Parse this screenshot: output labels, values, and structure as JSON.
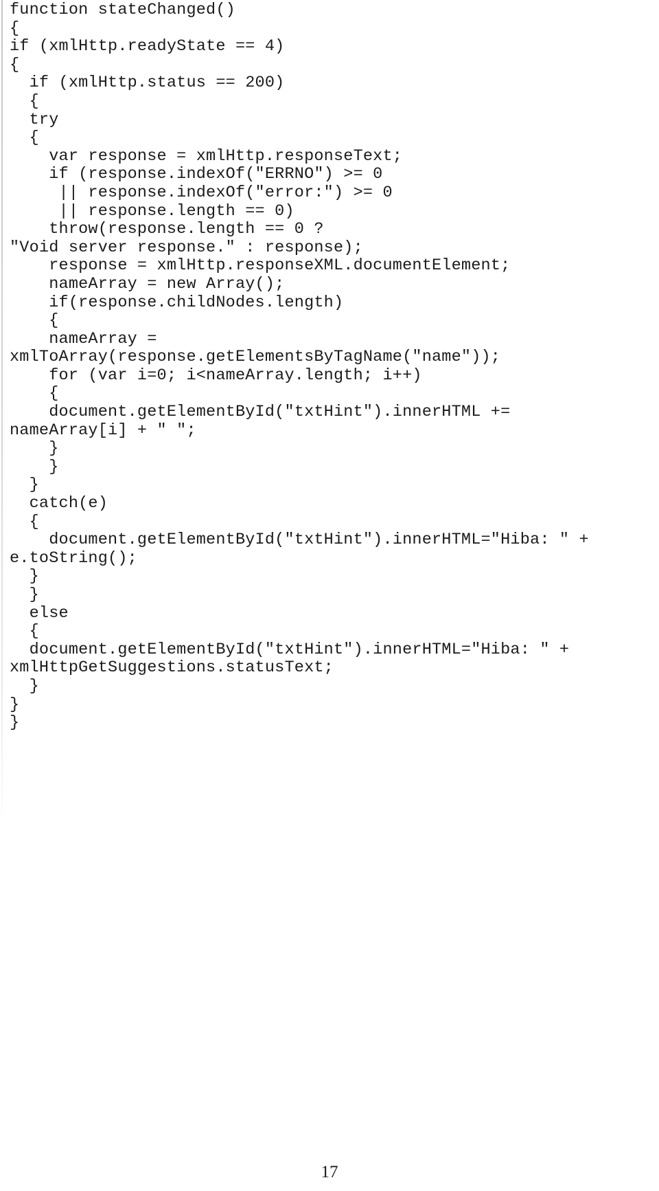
{
  "document": {
    "page_number": "17",
    "content_type": "source-code-listing",
    "language": "JavaScript",
    "code_lines": [
      "function stateChanged()",
      "{",
      "if (xmlHttp.readyState == 4)",
      "{",
      "  if (xmlHttp.status == 200)",
      "  {",
      "  try",
      "  {",
      "    var response = xmlHttp.responseText;",
      "    if (response.indexOf(\"ERRNO\") >= 0",
      "     || response.indexOf(\"error:\") >= 0",
      "     || response.length == 0)",
      "    throw(response.length == 0 ?",
      "\"Void server response.\" : response);",
      "    response = xmlHttp.responseXML.documentElement;",
      "    nameArray = new Array();",
      "    if(response.childNodes.length)",
      "    {",
      "    nameArray =",
      "xmlToArray(response.getElementsByTagName(\"name\"));",
      "    for (var i=0; i<nameArray.length; i++)",
      "    {",
      "    document.getElementById(\"txtHint\").innerHTML +=",
      "nameArray[i] + \" \";",
      "    }",
      "    }",
      "  }",
      "  catch(e)",
      "  {",
      "    document.getElementById(\"txtHint\").innerHTML=\"Hiba: \" +",
      "e.toString();",
      "  }",
      "  }",
      "  else",
      "  {",
      "  document.getElementById(\"txtHint\").innerHTML=\"Hiba: \" +",
      "xmlHttpGetSuggestions.statusText;",
      "  }",
      "}",
      "}"
    ]
  }
}
